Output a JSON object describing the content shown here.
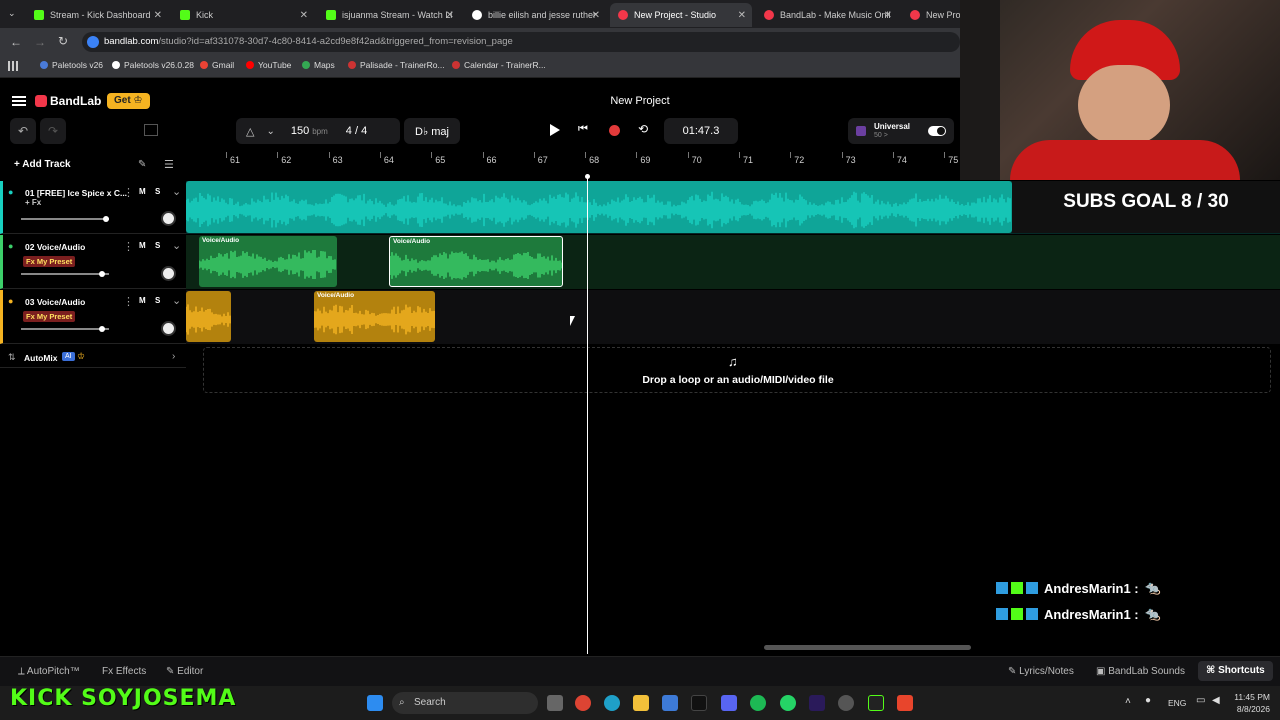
{
  "browser": {
    "tabs": [
      {
        "label": "Stream - Kick Dashboard",
        "color": "#53fc18"
      },
      {
        "label": "Kick",
        "color": "#53fc18"
      },
      {
        "label": "isjuanma Stream - Watch Li",
        "color": "#53fc18"
      },
      {
        "label": "billie eilish and jesse ruther",
        "color": "#ffffff"
      },
      {
        "label": "New Project - Studio",
        "color": "#f2374a"
      },
      {
        "label": "BandLab - Make Music Onli",
        "color": "#f2374a"
      },
      {
        "label": "New Proje",
        "color": "#f2374a"
      }
    ],
    "url_host": "bandlab.com",
    "url_rest": "/studio?id=af331078-30d7-4c80-8414-a2cd9e8f42ad&triggered_from=revision_page",
    "bookmarks": [
      "Paletools v26",
      "Paletools v26.0.28",
      "Gmail",
      "YouTube",
      "Maps",
      "Palisade - TrainerRo...",
      "Calendar - TrainerR..."
    ]
  },
  "app": {
    "brand": "BandLab",
    "get_label": "Get",
    "project_title": "New Project",
    "tempo": "150",
    "tempo_unit": "bpm",
    "time_sig": "4 / 4",
    "key": "D♭ maj",
    "time": "01:47.3",
    "universal_label": "Universal",
    "universal_sub": "50 >",
    "add_track": "Add Track",
    "ruler": [
      "61",
      "62",
      "63",
      "64",
      "65",
      "66",
      "67",
      "68",
      "69",
      "70",
      "71",
      "72",
      "73",
      "74",
      "75"
    ],
    "tracks": [
      {
        "name": "01  [FREE] Ice Spice x C...",
        "fx": "+ Fx",
        "fx_preset": false,
        "color": "#18d0c0"
      },
      {
        "name": "02  Voice/Audio",
        "fx": "Fx My Preset",
        "fx_preset": true,
        "color": "#3ccf6a"
      },
      {
        "name": "03  Voice/Audio",
        "fx": "Fx My Preset",
        "fx_preset": true,
        "color": "#f5b321"
      }
    ],
    "clip_label": "Voice/Audio",
    "automix": "AutoMix",
    "ai_badge": "AI",
    "drop_text": "Drop a loop or an audio/MIDI/video file",
    "bottom": {
      "autopitch": "AutoPitch™",
      "effects": "Effects",
      "editor": "Editor",
      "lyrics": "Lyrics/Notes",
      "sounds": "BandLab Sounds",
      "shortcuts": "Shortcuts"
    }
  },
  "overlay": {
    "subs_goal": "SUBS GOAL 8 / 30",
    "chat": [
      "AndresMarin1 :",
      "AndresMarin1 :"
    ],
    "channel": "KICK SOYJOSEMA"
  },
  "taskbar": {
    "search": "Search",
    "lang": "ENG",
    "clock_time": "11:45 PM",
    "clock_date": "8/8/2026"
  }
}
